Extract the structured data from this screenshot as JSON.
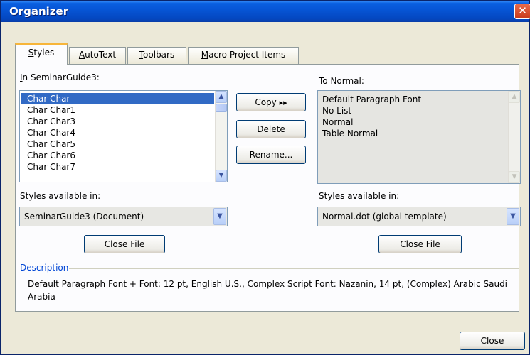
{
  "window": {
    "title": "Organizer",
    "close_glyph": "✕"
  },
  "tabs": [
    {
      "label": "Styles",
      "accel": "S",
      "active": true
    },
    {
      "label": "AutoText",
      "accel": "A",
      "active": false
    },
    {
      "label": "Toolbars",
      "accel": "T",
      "active": false
    },
    {
      "label": "Macro Project Items",
      "accel": "M",
      "active": false
    }
  ],
  "left_panel": {
    "label": "In SeminarGuide3:",
    "items": [
      "Char Char",
      "Char Char1",
      "Char Char3",
      "Char Char4",
      "Char Char5",
      "Char Char6",
      "Char Char7"
    ],
    "selected": "Char Char",
    "available_label": "Styles available in:",
    "available_value": "SeminarGuide3 (Document)",
    "close_file_label": "Close File"
  },
  "right_panel": {
    "label": "To Normal:",
    "items": [
      "Default Paragraph Font",
      "No List",
      "Normal",
      "Table Normal"
    ],
    "available_label": "Styles available in:",
    "available_value": "Normal.dot (global template)",
    "close_file_label": "Close File"
  },
  "actions": {
    "copy_label": "Copy",
    "copy_arrows": "▸▸",
    "delete_label": "Delete",
    "rename_label": "Rename..."
  },
  "description": {
    "label": "Description",
    "text": "Default Paragraph Font + Font: 12 pt, English U.S., Complex Script Font: Nazanin, 14 pt, (Complex) Arabic Saudi Arabia"
  },
  "footer": {
    "close_label": "Close"
  },
  "icons": {
    "scroll_up": "▲",
    "scroll_down": "▼",
    "dropdown": "▼"
  },
  "colors": {
    "title_bar": "#0654d4",
    "selection": "#316ac5",
    "description_label": "#0046d5",
    "tab_highlight": "#f7b53a"
  }
}
